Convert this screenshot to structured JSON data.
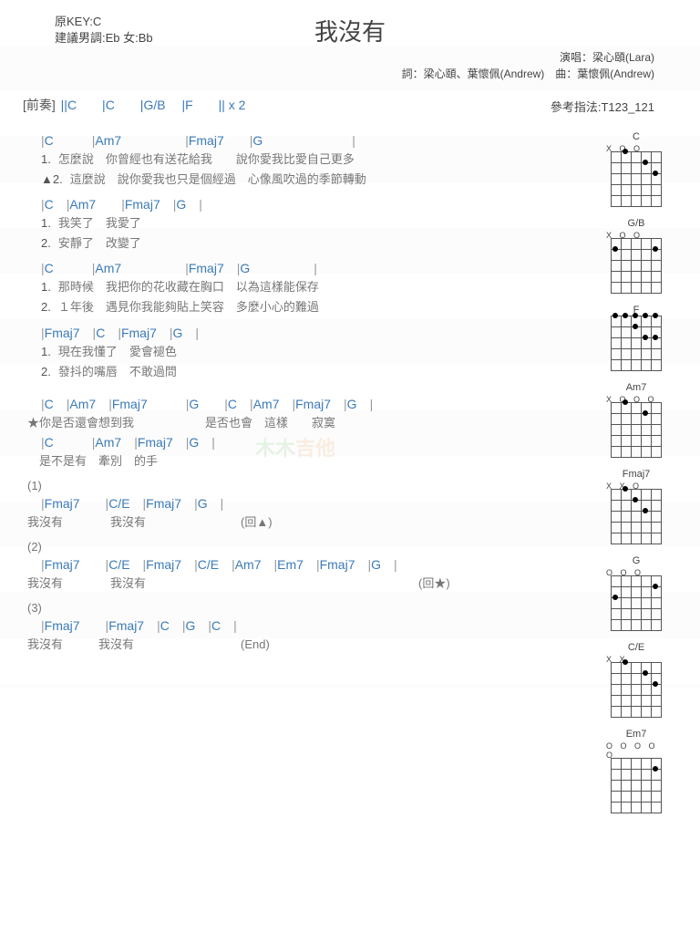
{
  "header": {
    "key_label": "原KEY:C",
    "tune_label": "建議男調:Eb 女:Bb",
    "title": "我沒有",
    "perf": "演唱：梁心頤(Lara)",
    "credits": "詞：梁心頤、葉懷佩(Andrew)　曲：葉懷佩(Andrew)"
  },
  "intro": {
    "label": "[前奏]",
    "chords": "||C　　|C　　|G/B　 |F　　|| x 2"
  },
  "ref_finger": "參考指法:T123_121",
  "watermark": "木木吉他",
  "chart_data": {
    "type": "table",
    "title": "Chord diagrams",
    "diagrams": [
      {
        "name": "C",
        "open": "X   O O",
        "dots": [
          [
            0,
            1
          ],
          [
            1,
            3
          ],
          [
            2,
            4
          ]
        ]
      },
      {
        "name": "G/B",
        "open": "X   O O",
        "dots": [
          [
            1,
            4
          ],
          [
            1,
            0
          ]
        ]
      },
      {
        "name": "F",
        "open": "",
        "dots": [
          [
            0,
            0
          ],
          [
            0,
            1
          ],
          [
            0,
            2
          ],
          [
            0,
            3
          ],
          [
            0,
            4
          ],
          [
            0,
            5
          ],
          [
            1,
            2
          ],
          [
            2,
            3
          ],
          [
            2,
            4
          ]
        ]
      },
      {
        "name": "Am7",
        "open": "X O   O O",
        "dots": [
          [
            0,
            1
          ],
          [
            1,
            3
          ]
        ]
      },
      {
        "name": "Fmaj7",
        "open": "X X     O",
        "dots": [
          [
            0,
            1
          ],
          [
            1,
            2
          ],
          [
            2,
            3
          ]
        ]
      },
      {
        "name": "G",
        "open": "    O O O",
        "dots": [
          [
            1,
            4
          ],
          [
            2,
            5
          ],
          [
            2,
            0
          ]
        ]
      },
      {
        "name": "C/E",
        "open": "X X",
        "dots": [
          [
            0,
            1
          ],
          [
            1,
            3
          ],
          [
            2,
            4
          ]
        ]
      },
      {
        "name": "Em7",
        "open": "O   O O O O",
        "dots": [
          [
            1,
            4
          ]
        ]
      }
    ]
  },
  "verses": [
    {
      "chords": "|C　　　|Am7　　　　　|Fmaj7　　|G　　　　　　　|",
      "lines": [
        {
          "n": "1.",
          "t": "怎麼說　你曾經也有送花給我　　說你愛我比愛自己更多"
        },
        {
          "n": "▲2.",
          "t": "這麼說　說你愛我也只是個經過　心像風吹過的季節轉動"
        }
      ]
    },
    {
      "chords": "|C　|Am7　　|Fmaj7　|G　|",
      "lines": [
        {
          "n": "1.",
          "t": "我笑了　我愛了"
        },
        {
          "n": "2.",
          "t": "安靜了　改變了"
        }
      ]
    },
    {
      "chords": "|C　　　|Am7　　　　　|Fmaj7　|G　　　　　|",
      "lines": [
        {
          "n": "1.",
          "t": "那時候　我把你的花收藏在胸口　以為這樣能保存"
        },
        {
          "n": "2.",
          "t": "１年後　遇見你我能夠貼上笑容　多麼小心的難過"
        }
      ]
    },
    {
      "chords": "|Fmaj7　|C　|Fmaj7　|G　|",
      "lines": [
        {
          "n": "1.",
          "t": "現在我懂了　愛會褪色"
        },
        {
          "n": "2.",
          "t": "發抖的嘴唇　不敢過問"
        }
      ]
    }
  ],
  "chorus": {
    "l1c": "|C　|Am7　|Fmaj7　　　|G　　|C　|Am7　|Fmaj7　|G　|",
    "l1": "★你是否還會想到我　　　　　　是否也會　這樣　　寂寞",
    "l2c": "|C　　　|Am7　|Fmaj7　|G　|",
    "l2": "　是不是有　牽別　的手"
  },
  "endings": [
    {
      "num": "(1)",
      "ch": "|Fmaj7　　|C/E　|Fmaj7　|G　|",
      "lyr": "我沒有　　　　我沒有　　　　　　　　(回▲)"
    },
    {
      "num": "(2)",
      "ch": "|Fmaj7　　|C/E　|Fmaj7　|C/E　|Am7　|Em7　|Fmaj7　|G　|",
      "lyr": "我沒有　　　　我沒有　　　　　　　　　　　　　　　　　　　　　　　(回★)"
    },
    {
      "num": "(3)",
      "ch": "|Fmaj7　　|Fmaj7　|C　|G　|C　|",
      "lyr": "我沒有　　　我沒有　　　　　　　　　(End)"
    }
  ]
}
